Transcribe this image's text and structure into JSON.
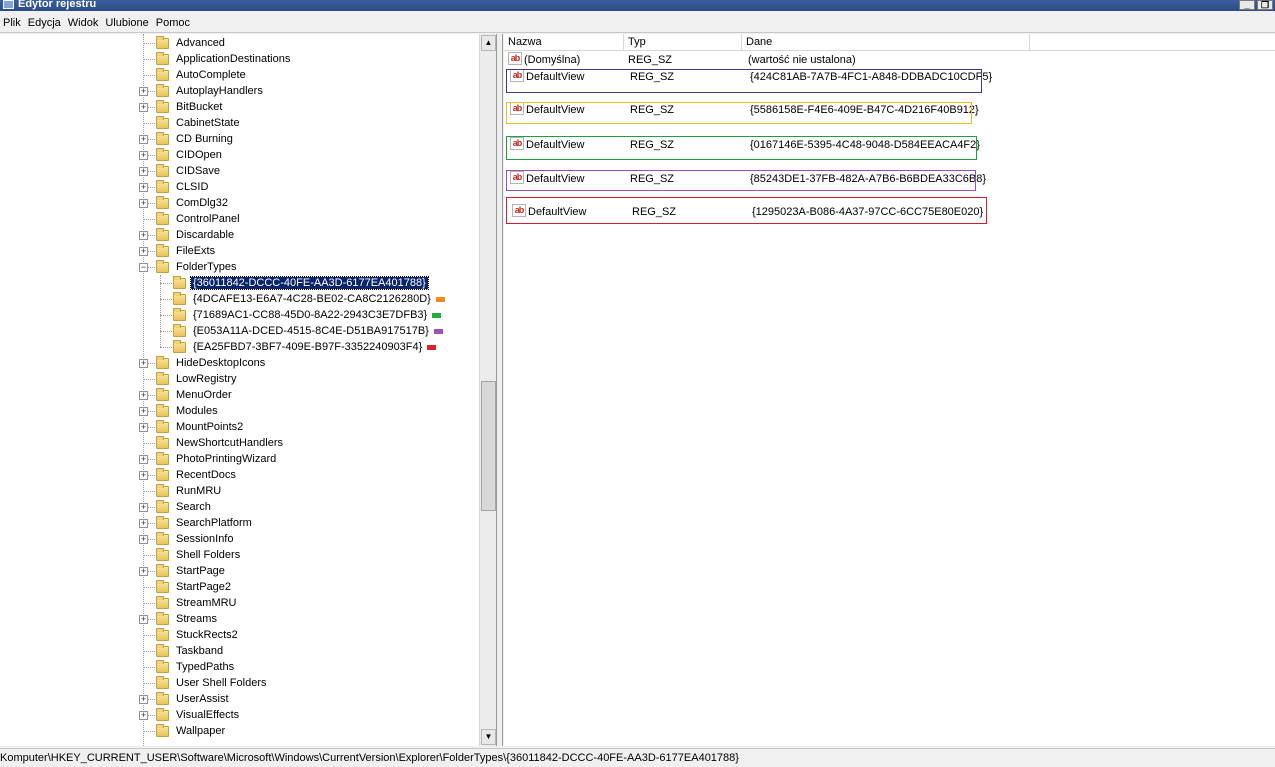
{
  "window": {
    "title": "Edytor rejestru",
    "controls": [
      "_",
      "❐",
      "✕"
    ]
  },
  "menu": [
    "Plik",
    "Edycja",
    "Widok",
    "Ulubione",
    "Pomoc"
  ],
  "tree": {
    "items": [
      {
        "label": "Advanced",
        "expander": false
      },
      {
        "label": "ApplicationDestinations",
        "expander": false
      },
      {
        "label": "AutoComplete",
        "expander": false
      },
      {
        "label": "AutoplayHandlers",
        "expander": true
      },
      {
        "label": "BitBucket",
        "expander": true
      },
      {
        "label": "CabinetState",
        "expander": false
      },
      {
        "label": "CD Burning",
        "expander": true
      },
      {
        "label": "CIDOpen",
        "expander": true
      },
      {
        "label": "CIDSave",
        "expander": true
      },
      {
        "label": "CLSID",
        "expander": true
      },
      {
        "label": "ComDlg32",
        "expander": true
      },
      {
        "label": "ControlPanel",
        "expander": false
      },
      {
        "label": "Discardable",
        "expander": true
      },
      {
        "label": "FileExts",
        "expander": true
      },
      {
        "label": "FolderTypes",
        "expander": "open"
      },
      {
        "label": "HideDesktopIcons",
        "expander": true
      },
      {
        "label": "LowRegistry",
        "expander": false
      },
      {
        "label": "MenuOrder",
        "expander": true
      },
      {
        "label": "Modules",
        "expander": true
      },
      {
        "label": "MountPoints2",
        "expander": true
      },
      {
        "label": "NewShortcutHandlers",
        "expander": false
      },
      {
        "label": "PhotoPrintingWizard",
        "expander": true
      },
      {
        "label": "RecentDocs",
        "expander": true
      },
      {
        "label": "RunMRU",
        "expander": false
      },
      {
        "label": "Search",
        "expander": true
      },
      {
        "label": "SearchPlatform",
        "expander": true
      },
      {
        "label": "SessionInfo",
        "expander": true
      },
      {
        "label": "Shell Folders",
        "expander": false
      },
      {
        "label": "StartPage",
        "expander": true
      },
      {
        "label": "StartPage2",
        "expander": false
      },
      {
        "label": "StreamMRU",
        "expander": false
      },
      {
        "label": "Streams",
        "expander": true
      },
      {
        "label": "StuckRects2",
        "expander": false
      },
      {
        "label": "Taskband",
        "expander": false
      },
      {
        "label": "TypedPaths",
        "expander": false
      },
      {
        "label": "User Shell Folders",
        "expander": false
      },
      {
        "label": "UserAssist",
        "expander": true
      },
      {
        "label": "VisualEffects",
        "expander": true
      },
      {
        "label": "Wallpaper",
        "expander": false
      }
    ],
    "subkeys": [
      {
        "label": "{36011842-DCCC-40FE-AA3D-6177EA401788}",
        "selected": true,
        "swatch": ""
      },
      {
        "label": "{4DCAFE13-E6A7-4C28-BE02-CA8C2126280D}",
        "selected": false,
        "swatch": "#f28a1e"
      },
      {
        "label": "{71689AC1-CC88-45D0-8A22-2943C3E7DFB3}",
        "selected": false,
        "swatch": "#1fae3a"
      },
      {
        "label": "{E053A11A-DCED-4515-8C4E-D51BA917517B}",
        "selected": false,
        "swatch": "#a050b0"
      },
      {
        "label": "{EA25FBD7-3BF7-409E-B97F-3352240903F4}",
        "selected": false,
        "swatch": "#e0202a"
      }
    ]
  },
  "list": {
    "columns": [
      "Nazwa",
      "Typ",
      "Dane"
    ],
    "rows": [
      {
        "name": "(Domyślna)",
        "type": "REG_SZ",
        "data": "(wartość nie ustalona)"
      },
      {
        "name": "DefaultView",
        "type": "REG_SZ",
        "data": "{424C81AB-7A7B-4FC1-A848-DDBADC10CDF5}",
        "box_color": "#3c3c78"
      },
      {
        "name": "DefaultView",
        "type": "REG_SZ",
        "data": "{5586158E-F4E6-409E-B47C-4D216F40B912}",
        "box_color": "#e8c020"
      },
      {
        "name": "DefaultView",
        "type": "REG_SZ",
        "data": "{0167146E-5395-4C48-9048-D584EEACA4F2}",
        "box_color": "#1fa040"
      },
      {
        "name": "DefaultView",
        "type": "REG_SZ",
        "data": "{85243DE1-37FB-482A-A7B6-B6BDEA33C6B8}",
        "box_color": "#9a50b0"
      },
      {
        "name": "DefaultView",
        "type": "REG_SZ",
        "data": "{1295023A-B086-4A37-97CC-6CC75E80E020}",
        "box_color": "#d02030"
      }
    ]
  },
  "statusbar": {
    "path": "Komputer\\HKEY_CURRENT_USER\\Software\\Microsoft\\Windows\\CurrentVersion\\Explorer\\FolderTypes\\{36011842-DCCC-40FE-AA3D-6177EA401788}"
  }
}
